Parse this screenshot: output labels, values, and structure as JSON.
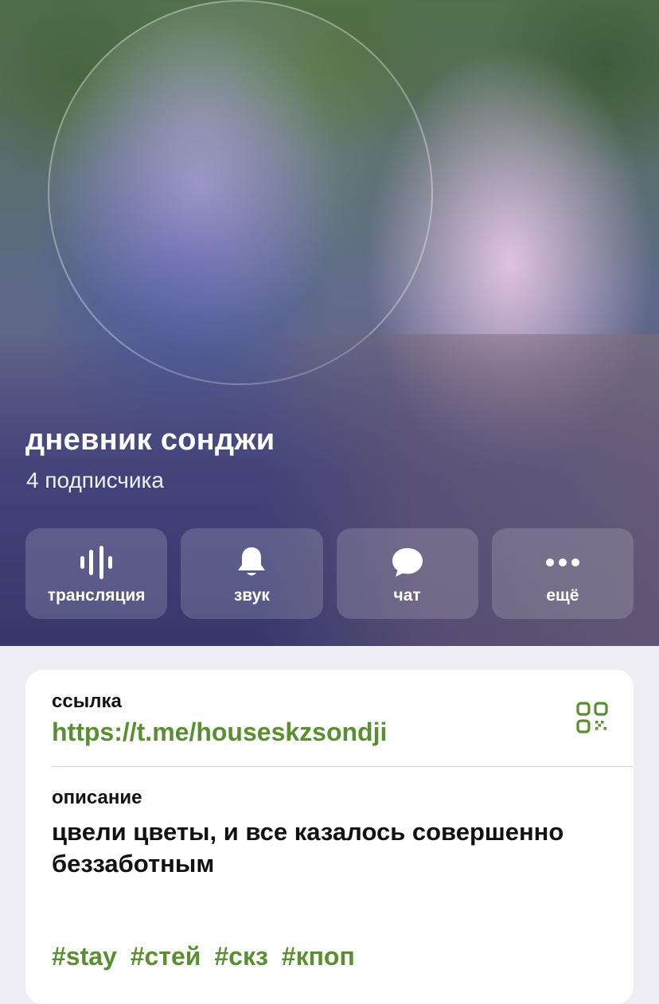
{
  "channel": {
    "title": "дневник сонджи",
    "subscribers": "4 подписчика"
  },
  "actions": [
    {
      "label": "трансляция",
      "icon": "live-stream-icon"
    },
    {
      "label": "звук",
      "icon": "bell-icon"
    },
    {
      "label": "чат",
      "icon": "chat-bubble-icon"
    },
    {
      "label": "ещё",
      "icon": "more-dots-icon"
    }
  ],
  "info": {
    "link_label": "ссылка",
    "link_value": "https://t.me/houseskzsondji",
    "description_label": "описание",
    "description_text": "цвели цветы, и все казалось совершенно беззаботным",
    "tags": [
      "#stay",
      "#стей",
      "#скз",
      "#кпоп"
    ]
  },
  "colors": {
    "accent": "#5a8f31",
    "background": "#efeef4",
    "card": "#ffffff"
  }
}
